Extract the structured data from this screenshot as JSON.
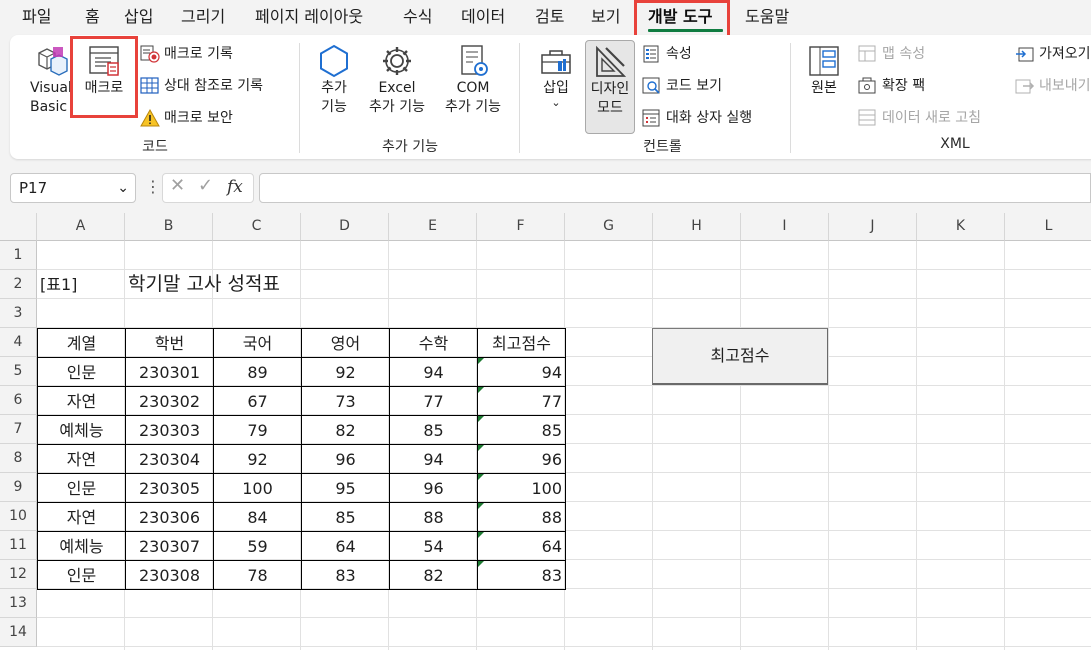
{
  "menu": {
    "tabs": [
      "파일",
      "홈",
      "삽입",
      "그리기",
      "페이지 레이아웃",
      "수식",
      "데이터",
      "검토",
      "보기",
      "개발 도구",
      "도움말"
    ],
    "active": "개발 도구"
  },
  "ribbon": {
    "code": {
      "visual_basic": "Visual\nBasic",
      "macro": "매크로",
      "record": "매크로 기록",
      "relative": "상대 참조로 기록",
      "security": "매크로 보안",
      "group": "코드"
    },
    "addins": {
      "addins": "추가\n기능",
      "excel_addins": "Excel\n추가 기능",
      "com_addins": "COM\n추가 기능",
      "group": "추가 기능"
    },
    "controls": {
      "insert": "삽입",
      "design_mode": "디자인\n모드",
      "properties": "속성",
      "view_code": "코드 보기",
      "run_dialog": "대화 상자 실행",
      "group": "컨트롤"
    },
    "xml": {
      "source": "원본",
      "map_props": "맵 속성",
      "expansion": "확장 팩",
      "refresh": "데이터 새로 고침",
      "import": "가져오기",
      "export": "내보내기",
      "group": "XML"
    }
  },
  "formula": {
    "name_box": "P17",
    "fx": "fx",
    "value": ""
  },
  "sheet": {
    "columns": [
      "A",
      "B",
      "C",
      "D",
      "E",
      "F",
      "G",
      "H",
      "I",
      "J",
      "K",
      "L"
    ],
    "rows": [
      "1",
      "2",
      "3",
      "4",
      "5",
      "6",
      "7",
      "8",
      "9",
      "10",
      "11",
      "12",
      "13",
      "14"
    ],
    "label": "[표1]",
    "title": "학기말 고사 성적표",
    "headers": [
      "계열",
      "학번",
      "국어",
      "영어",
      "수학",
      "최고점수"
    ],
    "data": [
      [
        "인문",
        "230301",
        "89",
        "92",
        "94",
        "94"
      ],
      [
        "자연",
        "230302",
        "67",
        "73",
        "77",
        "77"
      ],
      [
        "예체능",
        "230303",
        "79",
        "82",
        "85",
        "85"
      ],
      [
        "자연",
        "230304",
        "92",
        "96",
        "94",
        "96"
      ],
      [
        "인문",
        "230305",
        "100",
        "95",
        "96",
        "100"
      ],
      [
        "자연",
        "230306",
        "84",
        "85",
        "88",
        "88"
      ],
      [
        "예체능",
        "230307",
        "59",
        "64",
        "54",
        "64"
      ],
      [
        "인문",
        "230308",
        "78",
        "83",
        "82",
        "83"
      ]
    ],
    "button": "최고점수"
  },
  "colors": {
    "accent": "#107c41",
    "highlight": "#e8423b",
    "error_indicator": "#1d7a32"
  }
}
